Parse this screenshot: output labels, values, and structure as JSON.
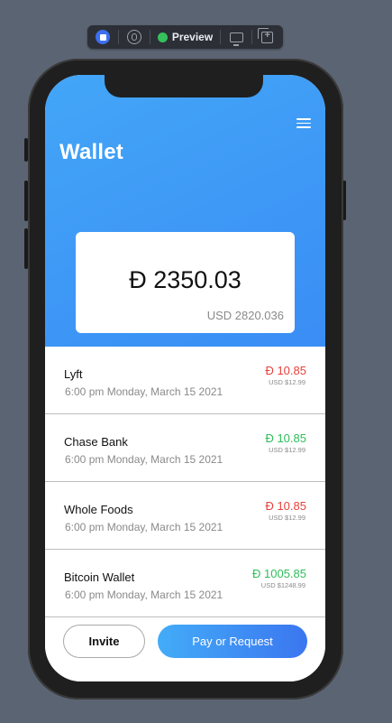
{
  "toolbar": {
    "preview_label": "Preview",
    "live_color": "#3d6ff0",
    "status_color": "#35c15b"
  },
  "app": {
    "title": "Wallet",
    "menu_icon": "hamburger-menu-icon",
    "brand_gradient": [
      "#43a6f7",
      "#3a8df5"
    ]
  },
  "balance": {
    "amount": "Đ 2350.03",
    "usd": "USD 2820.036"
  },
  "transactions": [
    {
      "name": "Lyft",
      "date": "6:00 pm Monday, March 15 2021",
      "amount": "Đ 10.85",
      "usd": "USD $12.99",
      "direction": "negative"
    },
    {
      "name": "Chase Bank",
      "date": "6:00 pm Monday, March 15 2021",
      "amount": "Đ 10.85",
      "usd": "USD $12.99",
      "direction": "positive"
    },
    {
      "name": "Whole Foods",
      "date": "6:00 pm Monday, March 15 2021",
      "amount": "Đ 10.85",
      "usd": "USD $12.99",
      "direction": "negative"
    },
    {
      "name": "Bitcoin Wallet",
      "date": "6:00 pm Monday, March 15 2021",
      "amount": "Đ 1005.85",
      "usd": "USD $1248.99",
      "direction": "positive"
    }
  ],
  "colors": {
    "negative": "#e8403b",
    "positive": "#2fbd5a"
  },
  "footer": {
    "invite_label": "Invite",
    "pay_label": "Pay or Request"
  }
}
